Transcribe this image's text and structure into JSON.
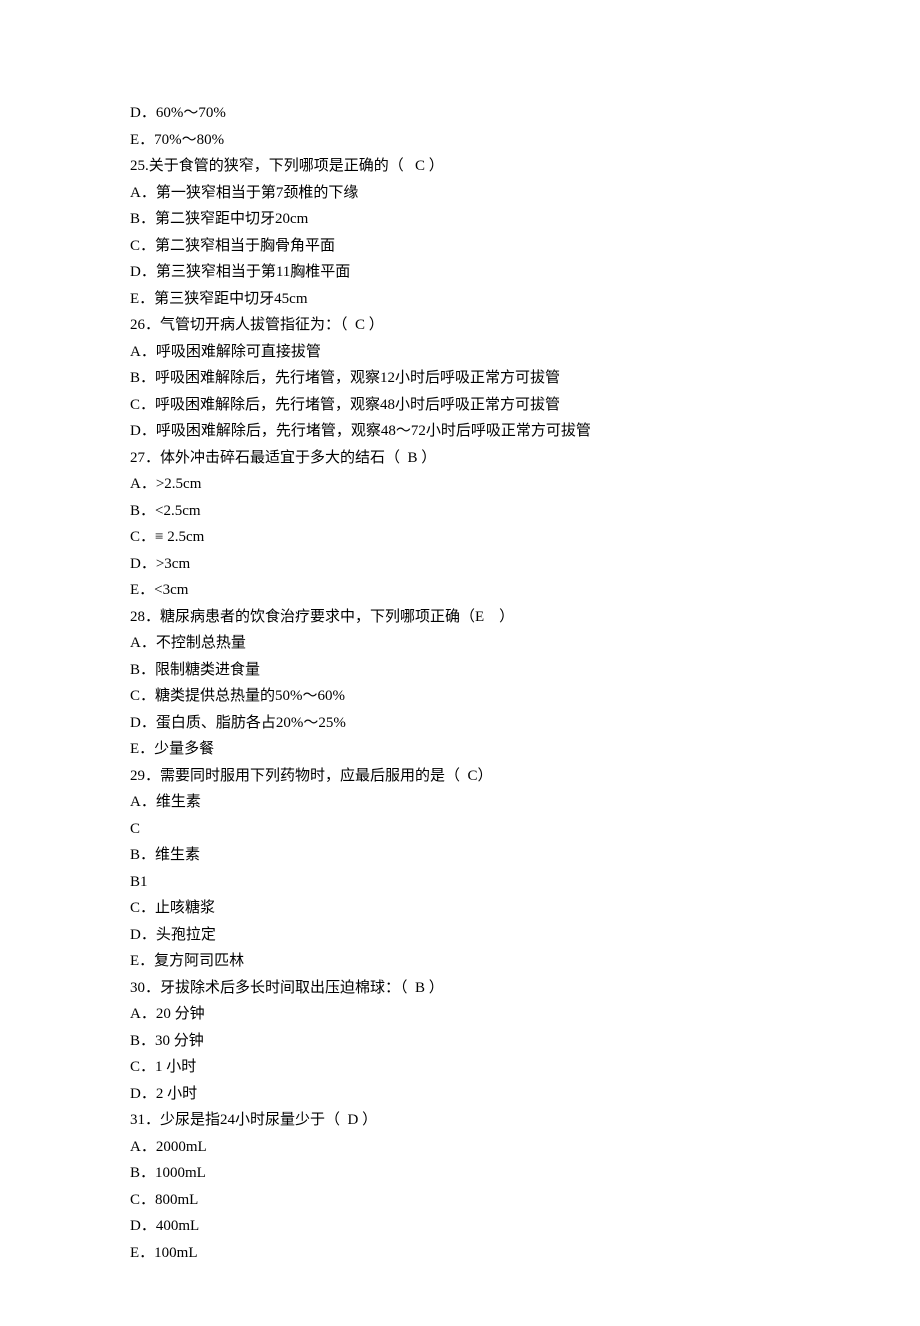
{
  "lines": [
    "D．60%〜70%",
    "E．70%〜80%",
    "25.关于食管的狭窄，下列哪项是正确的（   C ）",
    "A．第一狭窄相当于第7颈椎的下缘",
    "B．第二狭窄距中切牙20cm",
    "C．第二狭窄相当于胸骨角平面",
    "D．第三狭窄相当于第11胸椎平面",
    "E．第三狭窄距中切牙45cm",
    "26．气管切开病人拔管指征为：（  C ）",
    "A．呼吸困难解除可直接拔管",
    "B．呼吸困难解除后，先行堵管，观察12小时后呼吸正常方可拔管",
    "C．呼吸困难解除后，先行堵管，观察48小时后呼吸正常方可拔管",
    "D．呼吸困难解除后，先行堵管，观察48〜72小时后呼吸正常方可拔管",
    "27．体外冲击碎石最适宜于多大的结石（  B ）",
    "A．>2.5cm",
    "B．<2.5cm",
    "C．≡ 2.5cm",
    "D．>3cm",
    "E．<3cm",
    "28．糖尿病患者的饮食治疗要求中，下列哪项正确（E    ）",
    "A．不控制总热量",
    "B．限制糖类进食量",
    "C．糖类提供总热量的50%〜60%",
    "D．蛋白质、脂肪各占20%〜25%",
    "E．少量多餐",
    "29．需要同时服用下列药物时，应最后服用的是（  C）",
    "A．维生素",
    "C",
    "B．维生素",
    "B1",
    "C．止咳糖浆",
    "D．头孢拉定",
    "E．复方阿司匹林",
    "30．牙拔除术后多长时间取出压迫棉球：（  B ）",
    "A．20 分钟",
    "B．30 分钟",
    "C．1 小时",
    "D．2 小时",
    "31．少尿是指24小时尿量少于（  D ）",
    "A．2000mL",
    "B．1000mL",
    "C．800mL",
    "D．400mL",
    "E．100mL"
  ]
}
